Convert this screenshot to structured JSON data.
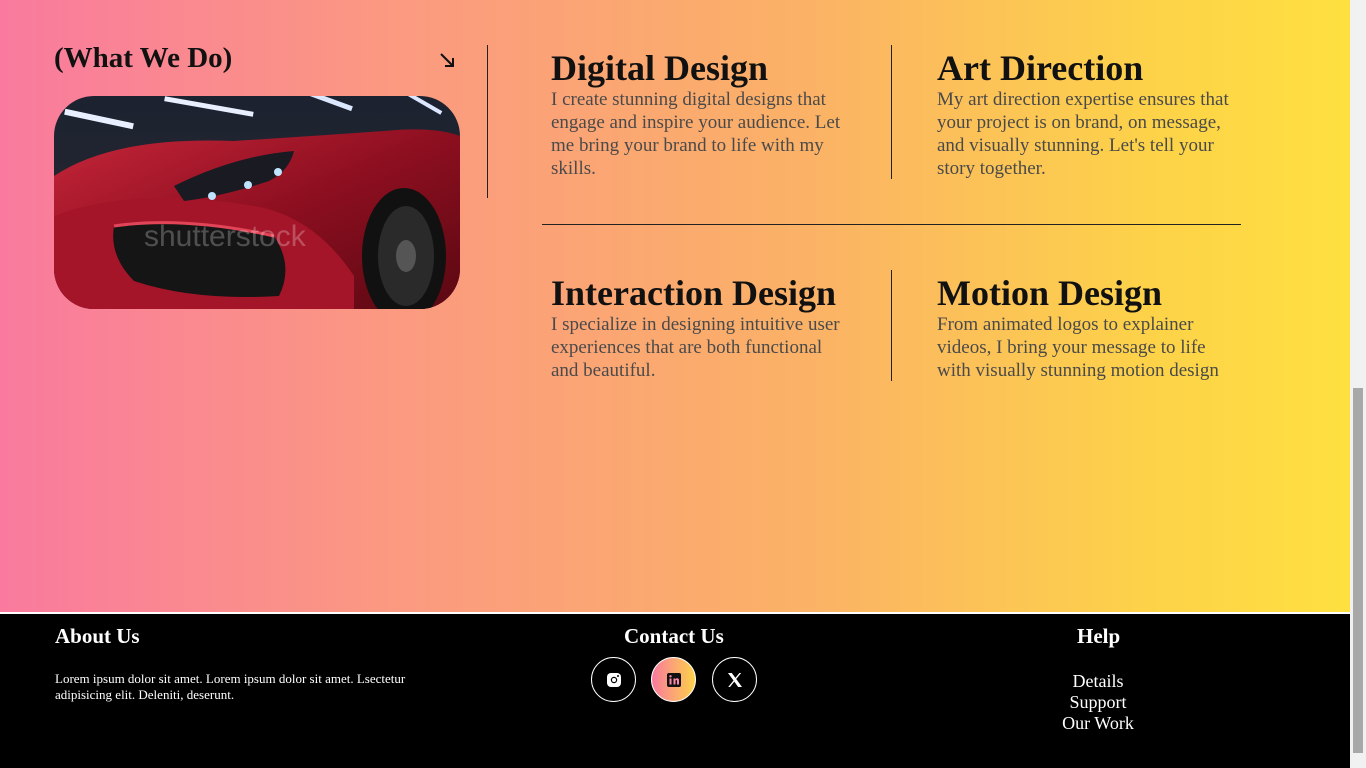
{
  "section": {
    "title": "(What We Do)",
    "image_watermark": "shutterstock"
  },
  "services": [
    {
      "title": "Digital Design",
      "description": "I create stunning digital designs that engage and inspire your audience. Let me bring your brand to life with my skills."
    },
    {
      "title": "Art Direction",
      "description": "My art direction expertise ensures that your project is on brand, on message, and visually stunning. Let's tell your story together."
    },
    {
      "title": "Interaction Design",
      "description": "I specialize in designing intuitive user experiences that are both functional and beautiful."
    },
    {
      "title": "Motion Design",
      "description": "From animated logos to explainer videos, I bring your message to life with visually stunning motion design"
    }
  ],
  "footer": {
    "about_title": "About Us",
    "about_text": "Lorem ipsum dolor sit amet. Lorem ipsum dolor sit amet. Lsectetur adipisicing elit. Deleniti, deserunt.",
    "contact_title": "Contact Us",
    "social": [
      {
        "icon": "instagram-icon"
      },
      {
        "icon": "linkedin-icon"
      },
      {
        "icon": "x-icon"
      }
    ],
    "help_title": "Help",
    "help_links": [
      "Details",
      "Support",
      "Our Work"
    ]
  },
  "colors": {
    "gradient_start": "#f97a9e",
    "gradient_end": "#fee040",
    "footer_bg": "#000000"
  }
}
